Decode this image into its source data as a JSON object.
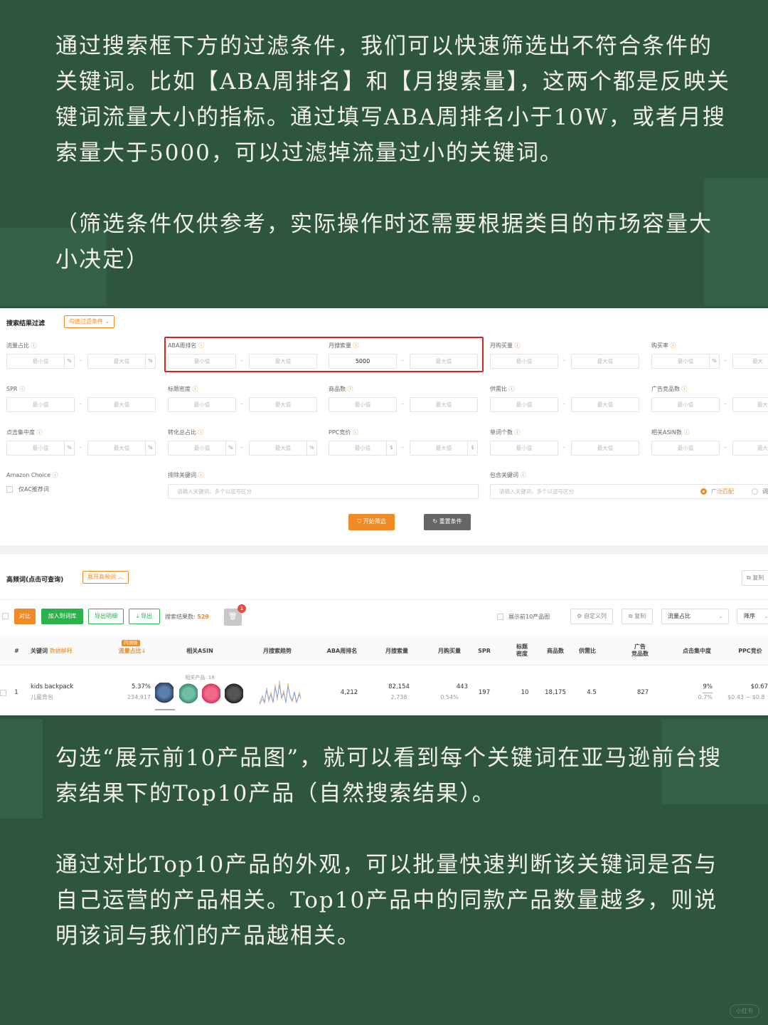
{
  "texts": {
    "intro": "通过搜索框下方的过滤条件，我们可以快速筛选出不符合条件的关键词。比如【ABA周排名】和【月搜索量】，这两个都是反映关键词流量大小的指标。通过填写ABA周排名小于10W，或者月搜索量大于5000，可以过滤掉流量过小的关键词。",
    "note": "（筛选条件仅供参考，实际操作时还需要根据类目的市场容量大小决定）",
    "para2": "勾选“展示前10产品图”，就可以看到每个关键词在亚马逊前台搜索结果下的Top10产品（自然搜索结果）。",
    "para3": "通过对比Top10产品的外观，可以批量快速判断该关键词是否与自己运营的产品相关。Top10产品中的同款产品数量越多，则说明该词与我们的产品越相关。"
  },
  "filter_panel": {
    "title": "搜索结果过滤",
    "tag_btn": "勾选过滤条件 ⌄",
    "min": "最小值",
    "max": "最大值",
    "max_cut": "最大值",
    "max_cut2": "最大",
    "min_cut": "最小值",
    "pct": "%",
    "dollar": "$",
    "dash": "–",
    "q": "ⓘ",
    "labels": {
      "traffic_share": "流量占比",
      "aba_rank": "ABA周排名",
      "monthly_search": "月搜索量",
      "monthly_buy": "月购买量",
      "buy_rate": "购买率",
      "spr": "SPR",
      "title_density": "标题密度",
      "product_count": "商品数",
      "supply_demand": "供需比",
      "ad_products": "广告竞品数",
      "click_concentration": "点击集中度",
      "conversion_share": "转化总占比",
      "ppc_bid": "PPC竞价",
      "word_count": "单词个数",
      "related_asin": "相关ASIN数",
      "amazon_choice": "Amazon Choice",
      "exclude_kw": "排除关键词",
      "include_kw": "包含关键词"
    },
    "monthly_search_min_value": "5000",
    "ac_only": "仅AC推荐词",
    "kw_placeholder": "请输入关键词，多个以逗号区分",
    "broad_match": "广泛匹配",
    "other_match": "词",
    "start_btn": "开始筛选",
    "reset_btn": "重置条件"
  },
  "results_panel": {
    "title": "高频词(点击可查询)",
    "expand_btn": "展开高频词 ︿",
    "copy_top": "复制",
    "compare_btn": "对比",
    "add_btn": "加入到词库",
    "export_detail_btn": "导出明细",
    "export_btn": "导出",
    "result_count_label": "搜索结果数:",
    "result_count": "529",
    "badge_count": "1",
    "show_top10": "展示前10产品图",
    "custom_cols": "自定义列",
    "copy_btn": "复制",
    "sort_field": "流量占比",
    "sort_order": "降序",
    "headers": {
      "num": "#",
      "keyword": "关键词",
      "keyword_tag": "数据解释",
      "badge": "内测版",
      "traffic_share": "流量占比↓",
      "related_asin": "相关ASIN",
      "trend": "月搜索趋势",
      "aba_rank": "ABA周排名",
      "monthly_search": "月搜索量",
      "monthly_buy": "月购买量",
      "spr": "SPR",
      "title_density_1": "标题",
      "title_density_2": "密度",
      "product_count": "商品数",
      "supply_demand": "供需比",
      "ad_products_1": "广告",
      "ad_products_2": "竞品数",
      "click_concentration": "点击集中度",
      "ppc_bid": "PPC竞价"
    },
    "rows": [
      {
        "num": "1",
        "keyword": "kids backpack",
        "keyword_cn": "儿童背包",
        "traffic_share": "5.37%",
        "traffic_share_sub": "234,917",
        "related_products": "相关产品: 18",
        "aba_rank": "4,212",
        "monthly_search": "82,154",
        "monthly_search_sub": "2,738",
        "monthly_buy": "443",
        "monthly_buy_sub": "0.54%",
        "spr": "197",
        "title_density": "10",
        "product_count": "18,175",
        "supply_demand": "4.5",
        "ad_products": "827",
        "click_concentration": "9%",
        "click_concentration_sub": "0.7%",
        "ppc_bid": "$0.67",
        "ppc_bid_sub": "$0.43 ~ $0.8"
      }
    ]
  },
  "watermark": "小红书",
  "colors": {
    "background": "#2d5540",
    "accent_orange": "#f08a24",
    "highlight_red": "#e0201b",
    "green": "#2bb24c"
  }
}
